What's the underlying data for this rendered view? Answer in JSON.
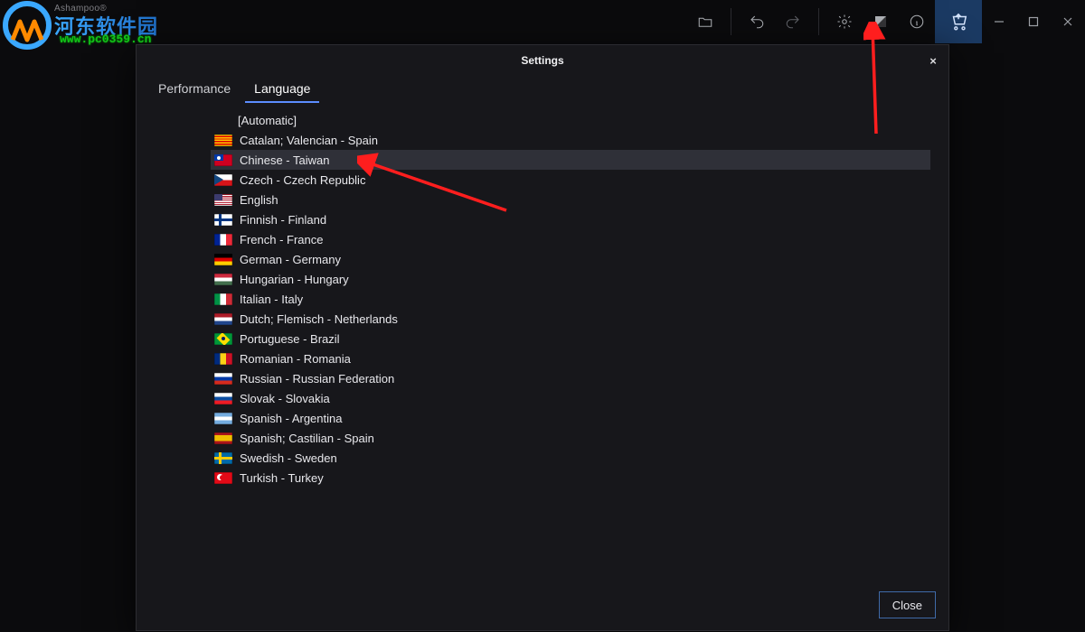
{
  "brand": "Ashampoo®",
  "watermark": {
    "text": "河东软件园",
    "url": "www.pc0359.cn"
  },
  "topbar": {
    "icons": {
      "folder": "folder-icon",
      "undo": "undo-icon",
      "redo": "redo-icon",
      "settings": "gear-icon",
      "theme": "theme-icon",
      "info": "info-icon",
      "cart": "cart-icon",
      "minimize": "minimize-icon",
      "maximize": "maximize-icon",
      "close": "close-icon"
    }
  },
  "dialog": {
    "title": "Settings",
    "close_x": "×",
    "tabs": [
      {
        "label": "Performance",
        "active": false
      },
      {
        "label": "Language",
        "active": true
      }
    ],
    "automatic_label": "[Automatic]",
    "languages": [
      {
        "flag": "flag-cat",
        "label": "Catalan; Valencian - Spain",
        "selected": false
      },
      {
        "flag": "flag-tw",
        "label": "Chinese - Taiwan",
        "selected": true
      },
      {
        "flag": "flag-cz",
        "label": "Czech - Czech Republic",
        "selected": false
      },
      {
        "flag": "flag-us",
        "label": "English",
        "selected": false
      },
      {
        "flag": "flag-fi",
        "label": "Finnish - Finland",
        "selected": false
      },
      {
        "flag": "flag-fr",
        "label": "French - France",
        "selected": false
      },
      {
        "flag": "flag-de",
        "label": "German - Germany",
        "selected": false
      },
      {
        "flag": "flag-hu",
        "label": "Hungarian - Hungary",
        "selected": false
      },
      {
        "flag": "flag-it",
        "label": "Italian - Italy",
        "selected": false
      },
      {
        "flag": "flag-nl",
        "label": "Dutch; Flemisch - Netherlands",
        "selected": false
      },
      {
        "flag": "flag-br",
        "label": "Portuguese - Brazil",
        "selected": false
      },
      {
        "flag": "flag-ro",
        "label": "Romanian - Romania",
        "selected": false
      },
      {
        "flag": "flag-ru",
        "label": "Russian - Russian Federation",
        "selected": false
      },
      {
        "flag": "flag-sk",
        "label": "Slovak - Slovakia",
        "selected": false
      },
      {
        "flag": "flag-ar",
        "label": "Spanish - Argentina",
        "selected": false
      },
      {
        "flag": "flag-es",
        "label": "Spanish; Castilian - Spain",
        "selected": false
      },
      {
        "flag": "flag-se",
        "label": "Swedish - Sweden",
        "selected": false
      },
      {
        "flag": "flag-tr",
        "label": "Turkish - Turkey",
        "selected": false
      }
    ],
    "footer": {
      "close_label": "Close"
    }
  }
}
